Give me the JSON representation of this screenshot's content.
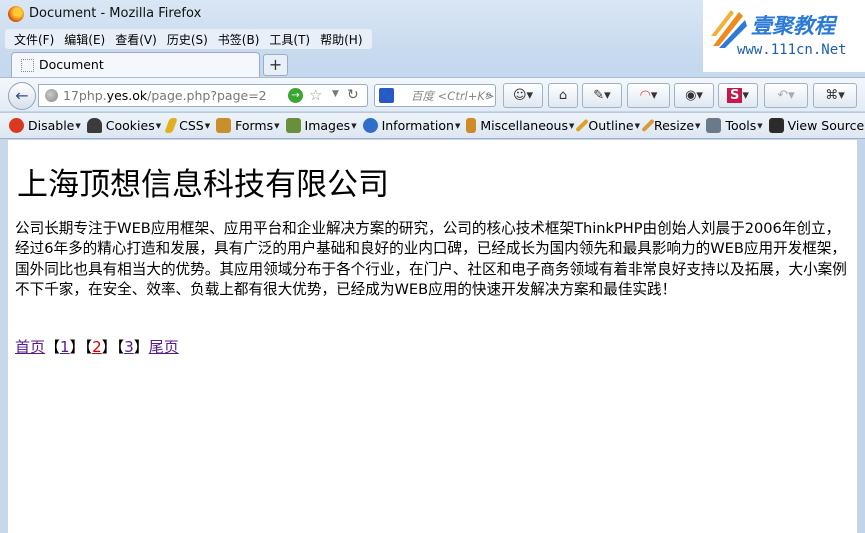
{
  "window": {
    "title": "Document - Mozilla Firefox"
  },
  "watermark": {
    "text": "壹聚教程",
    "url": "www.111cn.Net"
  },
  "menu": [
    "文件(F)",
    "编辑(E)",
    "查看(V)",
    "历史(S)",
    "书签(B)",
    "工具(T)",
    "帮助(H)"
  ],
  "tab": {
    "label": "Document",
    "new_tab": "+"
  },
  "url": {
    "prefix": "17php.",
    "domain": "yes.ok",
    "path": "/page.php?page=2"
  },
  "search": {
    "placeholder": "百度 <Ctrl+K>"
  },
  "devbar": [
    {
      "label": "Disable",
      "icon": "disable-icon",
      "color": "#d93a1f"
    },
    {
      "label": "Cookies",
      "icon": "cookies-icon",
      "color": "#3b3b3b"
    },
    {
      "label": "CSS",
      "icon": "css-icon",
      "color": "#e0b020"
    },
    {
      "label": "Forms",
      "icon": "forms-icon",
      "color": "#c8902a"
    },
    {
      "label": "Images",
      "icon": "images-icon",
      "color": "#6a8f3a"
    },
    {
      "label": "Information",
      "icon": "information-icon",
      "color": "#2f6fc9"
    },
    {
      "label": "Miscellaneous",
      "icon": "miscellaneous-icon",
      "color": "#d08a2a"
    },
    {
      "label": "Outline",
      "icon": "outline-icon",
      "color": "#e0a020"
    },
    {
      "label": "Resize",
      "icon": "resize-icon",
      "color": "#d89a3a"
    },
    {
      "label": "Tools",
      "icon": "tools-icon",
      "color": "#6a7a8a"
    },
    {
      "label": "View Source",
      "icon": "view-source-icon",
      "color": "#2b2b2b"
    }
  ],
  "page": {
    "heading": "上海顶想信息科技有限公司",
    "intro": "公司长期专注于WEB应用框架、应用平台和企业解决方案的研究，公司的核心技术框架ThinkPHP由创始人刘晨于2006年创立，经过6年多的精心打造和发展，具有广泛的用户基础和良好的业内口碑，已经成长为国内领先和最具影响力的WEB应用开发框架，国外同比也具有相当大的优势。其应用领域分布于各个行业，在门户、社区和电子商务领域有着非常良好支持以及拓展，大小案例不下千家，在安全、效率、负载上都有很大优势，已经成为WEB应用的快速开发解决方案和最佳实践！",
    "pager": {
      "first": "首页",
      "pages": [
        "1",
        "2",
        "3"
      ],
      "current": "2",
      "last": "尾页",
      "open": "【",
      "close": "】"
    }
  }
}
